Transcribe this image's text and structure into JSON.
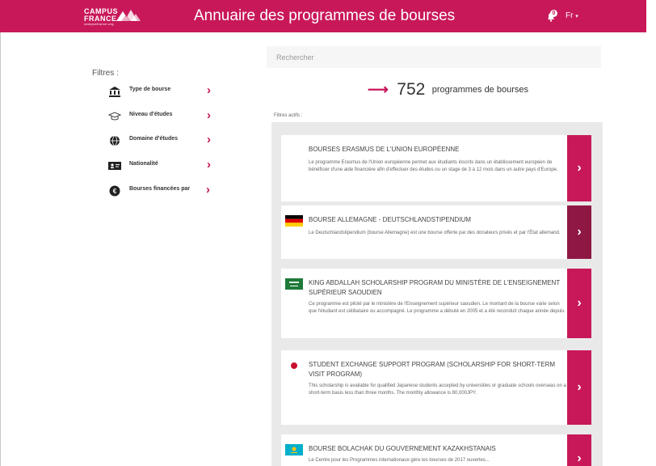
{
  "header": {
    "logo_line1": "CAMPUS",
    "logo_line2": "FRANCE",
    "logo_line3": "campusfrance.org",
    "title": "Annuaire des programmes de bourses",
    "notification_count": "0",
    "language": "Fr"
  },
  "sidebar": {
    "title": "Filtres :",
    "items": [
      {
        "label": "Type de bourse",
        "icon": "bank-icon"
      },
      {
        "label": "Niveau d'études",
        "icon": "graduation-cap-icon"
      },
      {
        "label": "Domaine d'études",
        "icon": "globe-icon"
      },
      {
        "label": "Nationalité",
        "icon": "id-card-icon"
      },
      {
        "label": "Bourses financées par",
        "icon": "euro-coin-icon"
      }
    ]
  },
  "search": {
    "placeholder": "Rechercher"
  },
  "results_count": {
    "number": "752",
    "label": "programmes de bourses"
  },
  "active_filters_label": "Filtres actifs :",
  "colors": {
    "accent": "#c8185a",
    "accent_dark": "#8e1843"
  },
  "results": [
    {
      "title": "BOURSES ERASMUS DE L'UNION EUROPÉENNE",
      "description": "Le programme Erasmus de l'Union européenne permet aux étudiants inscrits dans un établissement européen de bénéficier d'une aide financière afin d'effectuer des études ou un stage de 3 à 12 mois dans un autre pays d'Europe.",
      "flag": "none"
    },
    {
      "title": "BOURSE ALLEMAGNE - DEUTSCHLANDSTIPENDIUM",
      "description": "Le Deutschlandstipendium (bourse Allemagne) est une bourse offerte par des donateurs privés et par l'État allemand.",
      "flag": "germany"
    },
    {
      "title": "KING ABDALLAH SCHOLARSHIP PROGRAM DU MINISTÈRE DE L'ENSEIGNEMENT SUPÉRIEUR SAOUDIEN",
      "description": "Ce programme est piloté par le ministère de l'Enseignement supérieur saoudien. Le montant de la bourse varie selon que l'étudiant est célibataire ou accompagné. Le programme a débuté en 2005 et a été reconduit chaque année depuis.",
      "flag": "saudi-arabia"
    },
    {
      "title": "STUDENT EXCHANGE SUPPORT PROGRAM (SCHOLARSHIP FOR SHORT-TERM VISIT PROGRAM)",
      "description": "This scholarship is available for qualified Japanese students accepted by universities or graduate schools overseas on a short-term basis less than three months. The monthly allowance is 80,000JPY.",
      "flag": "japan"
    },
    {
      "title": "BOURSE BOLACHAK DU GOUVERNEMENT KAZAKHSTANAIS",
      "description": "Le Centre pour les Programmes internationaux gère les bourses de 2017 ouvertes...",
      "flag": "kazakhstan"
    }
  ]
}
